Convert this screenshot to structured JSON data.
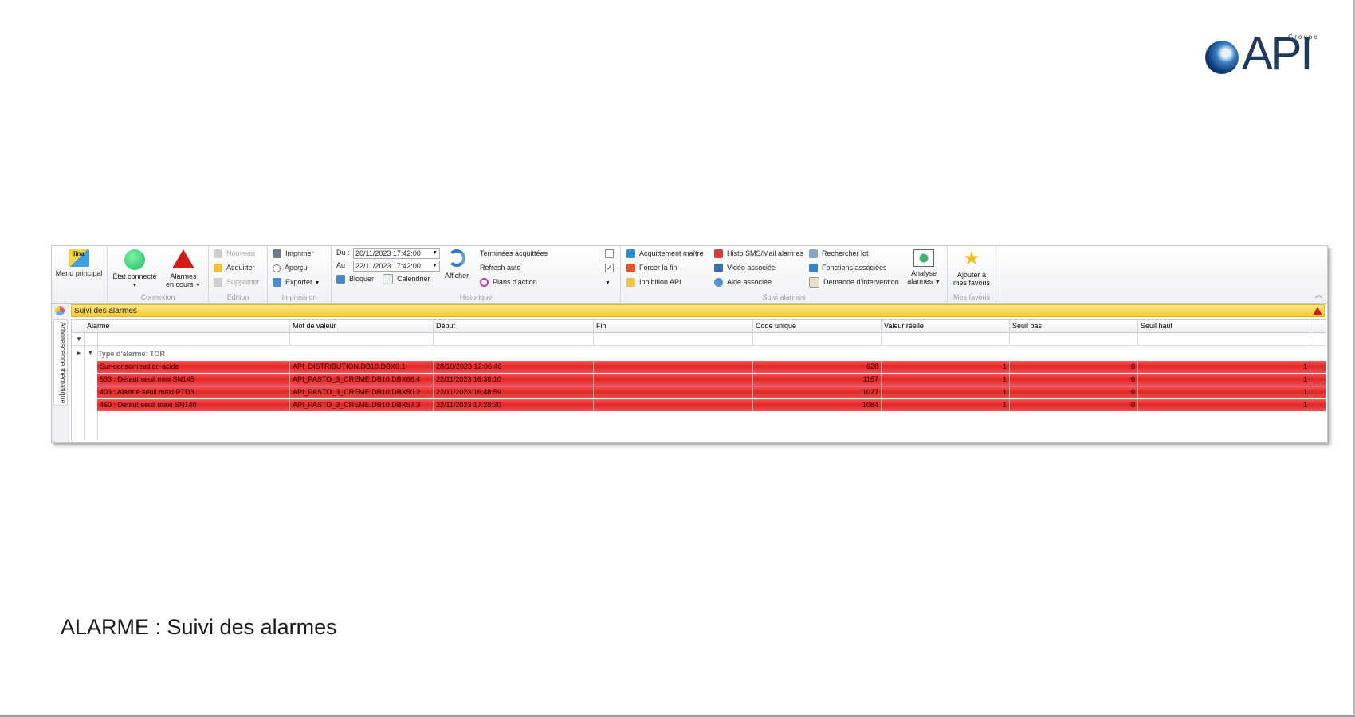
{
  "logo": {
    "groupe": "Groupe",
    "name": "API"
  },
  "ribbon": {
    "menu_principal": "Menu principal",
    "lina_text": "lina",
    "connexion": {
      "label": "Connexion",
      "etat": "Etat connecté",
      "alarmes_line1": "Alarmes",
      "alarmes_line2": "en cours"
    },
    "edition": {
      "label": "Edition",
      "nouveau": "Nouveau",
      "acquitter": "Acquitter",
      "supprimer": "Supprimer"
    },
    "impression": {
      "label": "Impression",
      "imprimer": "Imprimer",
      "apercu": "Aperçu",
      "exporter": "Exporter"
    },
    "historique": {
      "label": "Historique",
      "du_label": "Du :",
      "du_value": "20/11/2023 17:42:00",
      "au_label": "Au :",
      "au_value": "22/11/2023 17:42:00",
      "bloquer": "Bloquer",
      "calendrier": "Calendrier",
      "afficher": "Afficher",
      "terminees": "Terminées acquittées",
      "refresh": "Refresh auto",
      "plans": "Plans d'action",
      "refresh_checked": true,
      "terminees_checked": false
    },
    "suivi": {
      "label": "Suivi alarmes",
      "acquittement": "Acquittement maître",
      "forcer": "Forcer la fin",
      "inhibition": "Inhibition API",
      "histo": "Histo SMS/Mail alarmes",
      "video": "Vidéo associée",
      "aide": "Aide associée",
      "rechercher": "Rechercher lot",
      "fonctions": "Fonctions associées",
      "demande": "Demande d'intervention",
      "analyse_line1": "Analyse",
      "analyse_line2": "alarmes"
    },
    "favoris": {
      "label": "Mes favoris",
      "line1": "Ajouter à",
      "line2": "mes favoris"
    }
  },
  "side_tab": "Arborescence thématique",
  "panel": {
    "title": "Suivi des alarmes",
    "columns": [
      "Alarme",
      "Mot de valeur",
      "Début",
      "Fin",
      "Code unique",
      "Valeur réelle",
      "Seuil bas",
      "Seuil haut"
    ],
    "group_label": "Type d'alarme: TOR",
    "rows": [
      {
        "alarme": "Sur-consommation acide",
        "mot": "API_DISTRIBUTION.DB10.DBX0.1",
        "debut": "28/10/2023 12:06:46",
        "fin": "",
        "code": "628",
        "valeur": "1",
        "bas": "0",
        "haut": "1"
      },
      {
        "alarme": "533 : Défaut seuil mini SN145",
        "mot": "API_PASTO_3_CREME.DB10.DBX66.4",
        "debut": "22/11/2023 16:38:10",
        "fin": "",
        "code": "1157",
        "valeur": "1",
        "bas": "0",
        "haut": "1"
      },
      {
        "alarme": "403 : Alarme seuil maxi PTD3",
        "mot": "API_PASTO_3_CREME.DB10.DBX50.2",
        "debut": "22/11/2023 16:48:59",
        "fin": "",
        "code": "1027",
        "valeur": "1",
        "bas": "0",
        "haut": "1"
      },
      {
        "alarme": "460 : Défaut seuil maxi SN140",
        "mot": "API_PASTO_3_CREME.DB10.DBX57.3",
        "debut": "22/11/2023 17:28:20",
        "fin": "",
        "code": "1084",
        "valeur": "1",
        "bas": "0",
        "haut": "1"
      }
    ]
  },
  "caption": "ALARME : Suivi des alarmes",
  "colors": {
    "alarm_row": "#e22525",
    "title_bar": "#f5c92f",
    "connected": "#2ecc71",
    "warning": "#d31b1b"
  }
}
